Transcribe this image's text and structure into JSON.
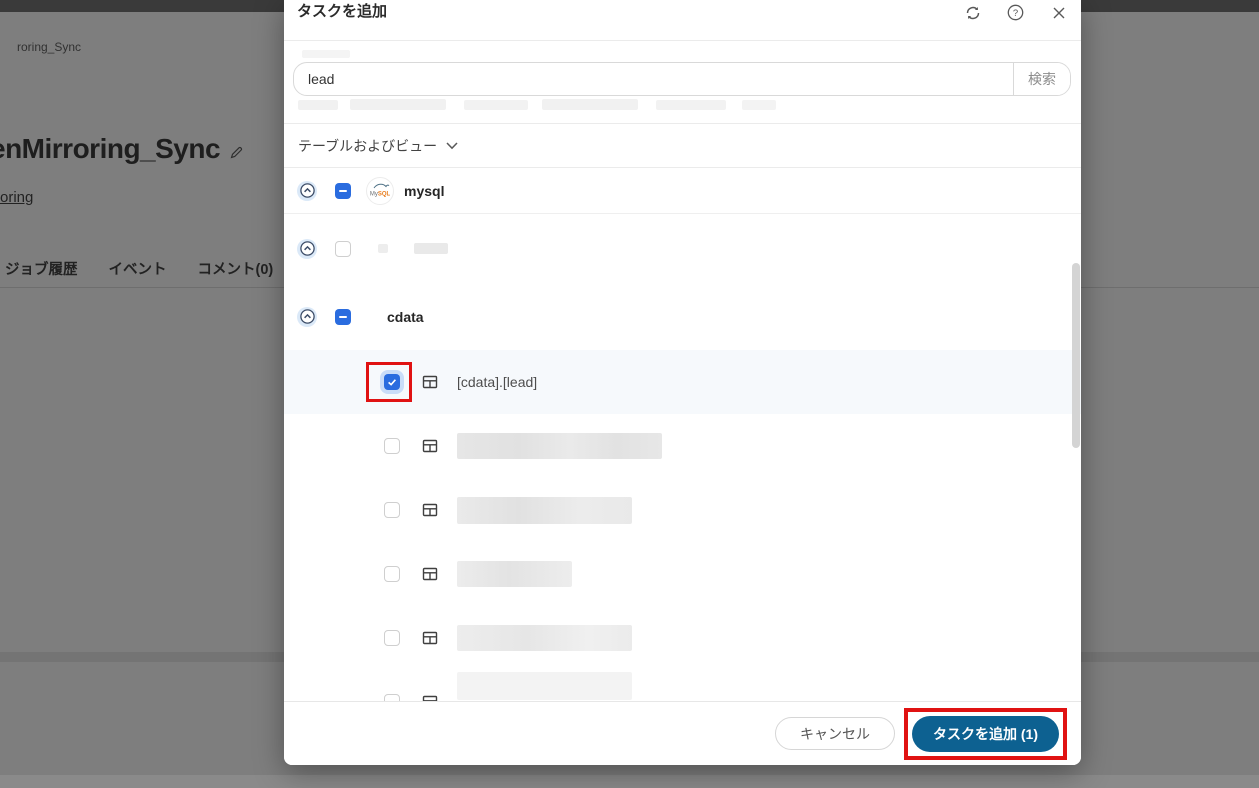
{
  "background": {
    "breadcrumb": "roring_Sync",
    "page_title": "enMirroring_Sync",
    "page_link": "oring",
    "tabs": [
      {
        "label": "ジョブ履歴"
      },
      {
        "label": "イベント"
      },
      {
        "label": "コメント(0)"
      }
    ]
  },
  "modal": {
    "title": "タスクを追加",
    "header_icons": [
      "refresh-icon",
      "help-icon",
      "close-icon"
    ],
    "search": {
      "value": "lead",
      "button_label": "検索"
    },
    "filter": {
      "label": "テーブルおよびビュー"
    },
    "tree": {
      "connection": {
        "name": "mysql",
        "checkbox": "indeterminate",
        "icon": "mysql-icon"
      },
      "schemas": [
        {
          "redacted": true,
          "checkbox": "unchecked"
        },
        {
          "name": "cdata",
          "checkbox": "indeterminate"
        }
      ],
      "tables": [
        {
          "name": "[cdata].[lead]",
          "checkbox": "checked",
          "selected": true,
          "highlighted": true
        },
        {
          "redacted": true,
          "checkbox": "unchecked"
        },
        {
          "redacted": true,
          "checkbox": "unchecked"
        },
        {
          "redacted": true,
          "checkbox": "unchecked"
        },
        {
          "redacted": true,
          "checkbox": "unchecked"
        },
        {
          "redacted": true,
          "checkbox": "unchecked"
        }
      ]
    },
    "footer": {
      "cancel_label": "キャンセル",
      "submit_label": "タスクを追加 (1)"
    }
  },
  "colors": {
    "checkbox_blue": "#2a6cdf",
    "primary_button": "#0d6191",
    "highlight_red": "#e01212",
    "selected_row_bg": "#f6f9fc"
  }
}
